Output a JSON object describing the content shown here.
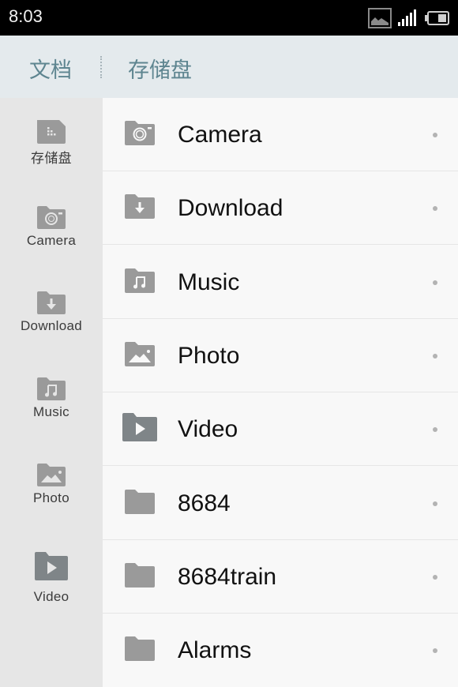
{
  "status_bar": {
    "time": "8:03",
    "icons": [
      "image-notification-icon",
      "signal-icon",
      "battery-icon"
    ]
  },
  "breadcrumb": {
    "root": "文档",
    "current": "存储盘"
  },
  "sidebar": {
    "items": [
      {
        "label": "存储盘",
        "icon": "sd-card-icon"
      },
      {
        "label": "Camera",
        "icon": "camera-folder-icon"
      },
      {
        "label": "Download",
        "icon": "download-folder-icon"
      },
      {
        "label": "Music",
        "icon": "music-folder-icon"
      },
      {
        "label": "Photo",
        "icon": "photo-folder-icon"
      },
      {
        "label": "Video",
        "icon": "video-folder-icon"
      }
    ]
  },
  "files": {
    "items": [
      {
        "name": "Camera",
        "icon": "camera-folder-icon"
      },
      {
        "name": "Download",
        "icon": "download-folder-icon"
      },
      {
        "name": "Music",
        "icon": "music-folder-icon"
      },
      {
        "name": "Photo",
        "icon": "photo-folder-icon"
      },
      {
        "name": "Video",
        "icon": "video-folder-icon"
      },
      {
        "name": "8684",
        "icon": "folder-icon"
      },
      {
        "name": "8684train",
        "icon": "folder-icon"
      },
      {
        "name": "Alarms",
        "icon": "folder-icon"
      }
    ]
  },
  "colors": {
    "breadcrumb_text": "#5e8590",
    "folder_icon": "#9a9a9a",
    "video_folder_icon": "#7f8588"
  }
}
